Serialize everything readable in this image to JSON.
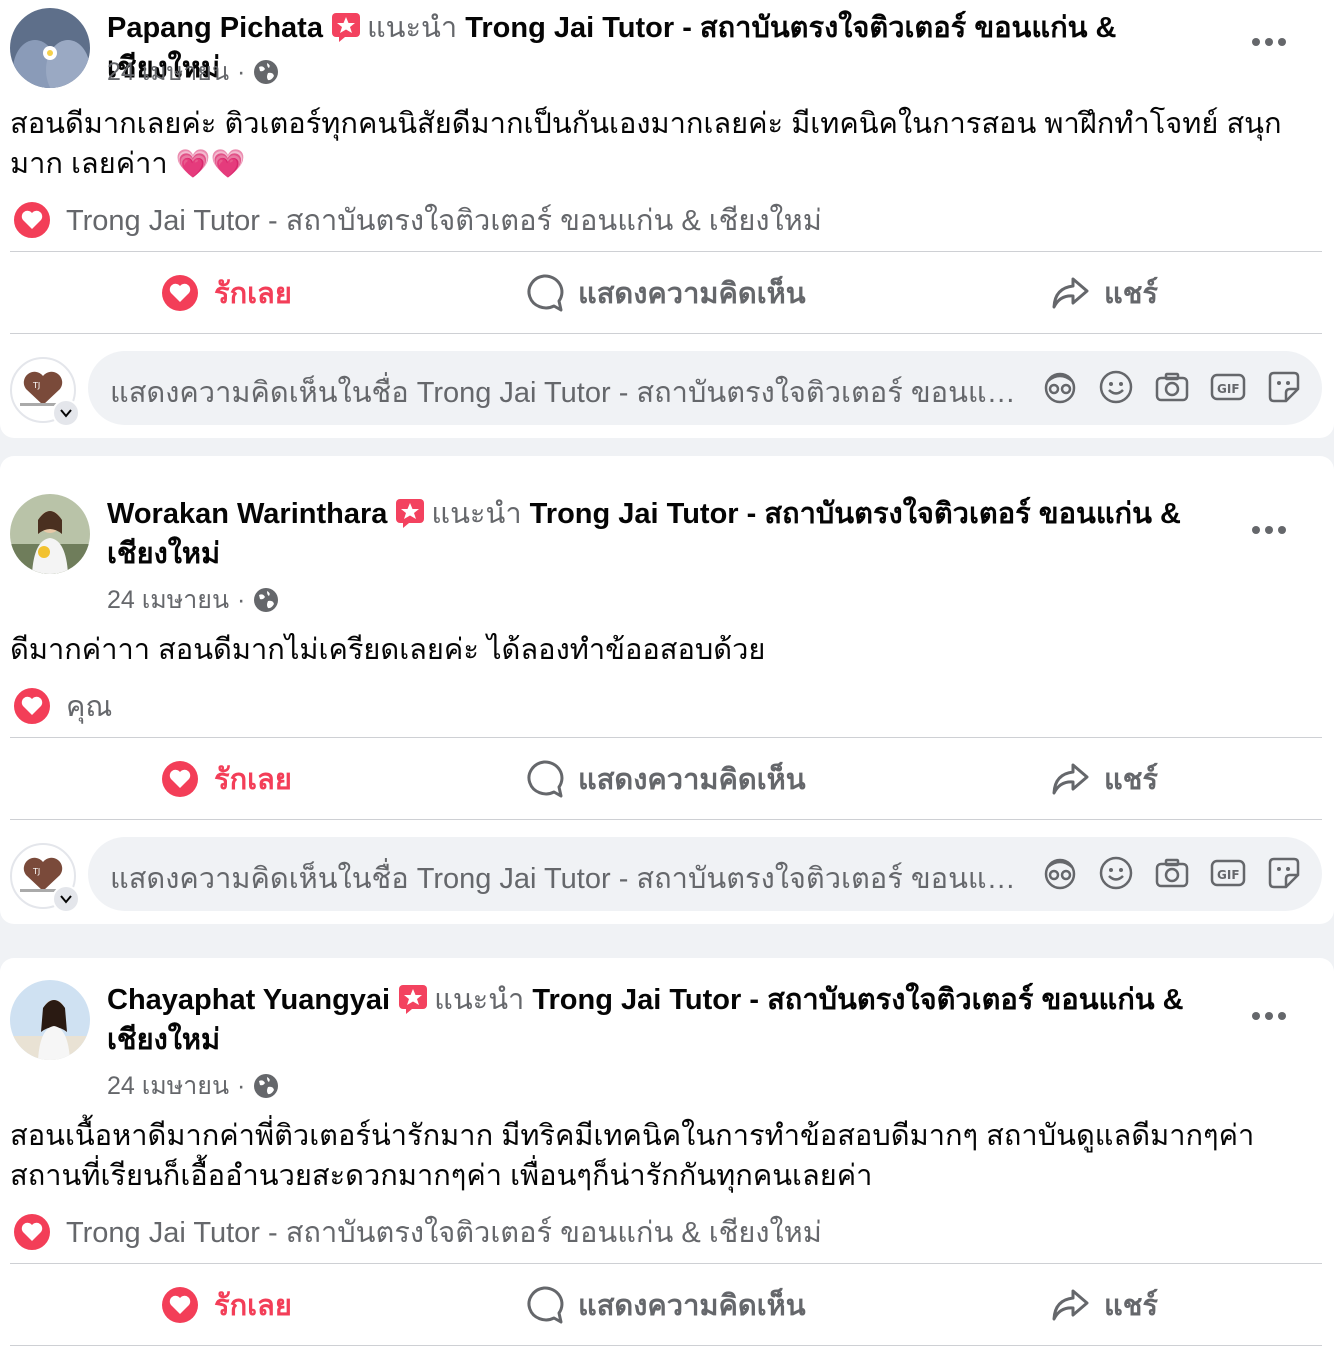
{
  "posts": [
    {
      "author": "Papang Pichata",
      "recommends_text": "แนะนำ",
      "page_name": "Trong Jai Tutor - สถาบันตรงใจติวเตอร์ ขอนแก่น & เชียงใหม่",
      "date": "24 เมษายน",
      "separator": "·",
      "text": "สอนดีมากเลยค่ะ ติวเตอร์ทุกคนนิสัยดีมากเป็นกันเองมากเลยค่ะ มีเทคนิคในการสอน พาฝึกทำโจทย์ สนุกมาก เลยค่าา",
      "emoji": "💗💗",
      "reactor": "Trong Jai Tutor - สถาบันตรงใจติวเตอร์ ขอนแก่น & เชียงใหม่"
    },
    {
      "author": "Worakan Warinthara",
      "recommends_text": "แนะนำ",
      "page_name": "Trong Jai Tutor - สถาบันตรงใจติวเตอร์ ขอนแก่น & เชียงใหม่",
      "date": "24 เมษายน",
      "separator": "·",
      "text": "ดีมากค่าาา  สอนดีมากไม่เครียดเลยค่ะ ได้ลองทำข้ออสอบด้วย",
      "reactor": "คุณ"
    },
    {
      "author": "Chayaphat Yuangyai",
      "recommends_text": "แนะนำ",
      "page_name": "Trong Jai Tutor - สถาบันตรงใจติวเตอร์ ขอนแก่น & เชียงใหม่",
      "date": "24 เมษายน",
      "separator": "·",
      "text": "สอนเนื้อหาดีมากค่าพี่ติวเตอร์น่ารักมาก มีทริคมีเทคนิคในการทำข้อสอบดีมากๆ สถาบันดูแลดีมากๆค่า สถานที่เรียนก็เอื้ออำนวยสะดวกมากๆค่า เพื่อนๆก็น่ารักกันทุกคนเลยค่า",
      "reactor": "Trong Jai Tutor - สถาบันตรงใจติวเตอร์ ขอนแก่น & เชียงใหม่"
    }
  ],
  "actions": {
    "love": "รักเลย",
    "comment": "แสดงความคิดเห็น",
    "share": "แชร์"
  },
  "composer": {
    "placeholder": "แสดงความคิดเห็นในชื่อ Trong Jai Tutor - สถาบันตรงใจติวเตอร์ ขอนแก่น & เชียงใหม่",
    "icons": [
      "avatar-sticker-icon",
      "emoji-icon",
      "camera-icon",
      "gif-icon",
      "sticker-icon"
    ]
  },
  "colors": {
    "love": "#f33e58",
    "secondary_text": "#65676b",
    "background": "#f0f2f5",
    "badge": "#f3425f"
  }
}
